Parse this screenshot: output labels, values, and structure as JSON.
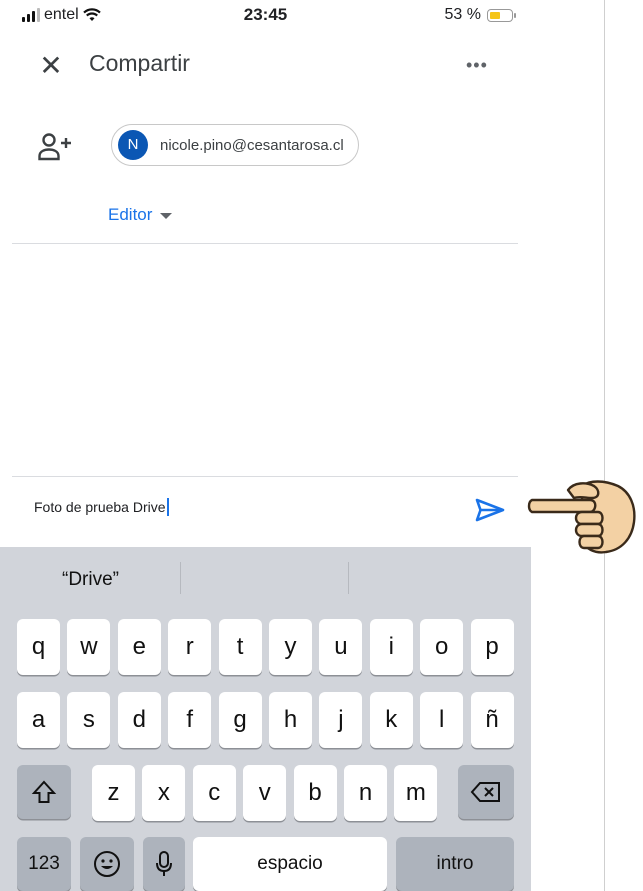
{
  "status_bar": {
    "carrier": "entel",
    "time": "23:45",
    "battery_text": "53 %",
    "battery_level": 0.53,
    "battery_color": "#f5c518"
  },
  "header": {
    "close_icon": "close-icon",
    "title": "Compartir",
    "more_icon": "more-horiz-icon"
  },
  "share": {
    "add_person_icon": "person-add-icon",
    "chip": {
      "initial": "N",
      "email": "nicole.pino@cesantarosa.cl",
      "avatar_color": "#0b57b4"
    },
    "role": "Editor"
  },
  "message": {
    "value": "Foto de prueba Drive",
    "send_icon": "send-icon",
    "accent": "#1a73e8"
  },
  "keyboard": {
    "suggestions": [
      "“Drive”",
      "",
      ""
    ],
    "row1": [
      "q",
      "w",
      "e",
      "r",
      "t",
      "y",
      "u",
      "i",
      "o",
      "p"
    ],
    "row2": [
      "a",
      "s",
      "d",
      "f",
      "g",
      "h",
      "j",
      "k",
      "l",
      "ñ"
    ],
    "row3": [
      "z",
      "x",
      "c",
      "v",
      "b",
      "n",
      "m"
    ],
    "shift_icon": "shift-icon",
    "backspace_icon": "backspace-icon",
    "numbers_label": "123",
    "emoji_icon": "emoji-icon",
    "mic_icon": "microphone-icon",
    "space_label": "espacio",
    "return_label": "intro"
  },
  "overlay": {
    "icon": "pointing-hand-icon"
  }
}
